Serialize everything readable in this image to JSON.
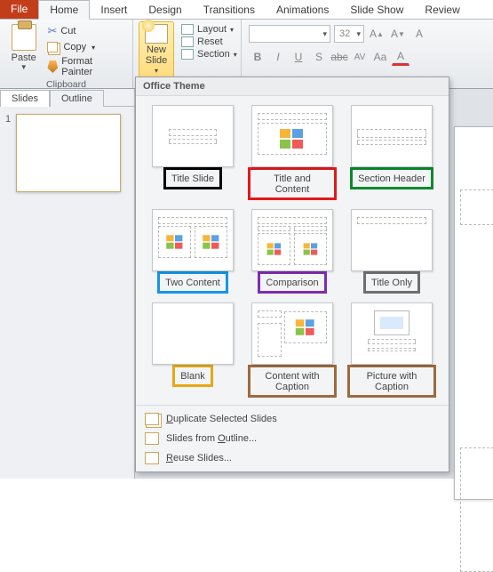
{
  "tabs": {
    "file": "File",
    "home": "Home",
    "insert": "Insert",
    "design": "Design",
    "transitions": "Transitions",
    "animations": "Animations",
    "slideshow": "Slide Show",
    "review": "Review"
  },
  "clipboard": {
    "group_label": "Clipboard",
    "paste_label": "Paste",
    "cut": "Cut",
    "copy": "Copy",
    "format_painter": "Format Painter"
  },
  "slides_group": {
    "new_slide_line1": "New",
    "new_slide_line2": "Slide",
    "layout": "Layout",
    "reset": "Reset",
    "section": "Section"
  },
  "font": {
    "family_placeholder": "",
    "size_value": "32"
  },
  "left_panel": {
    "tab_slides": "Slides",
    "tab_outline": "Outline",
    "slide_number": "1"
  },
  "gallery": {
    "header": "Office Theme",
    "items": [
      {
        "label": "Title Slide",
        "hl": "hl-black",
        "thumb": "title"
      },
      {
        "label": "Title and Content",
        "hl": "hl-red",
        "thumb": "title_content"
      },
      {
        "label": "Section Header",
        "hl": "hl-green",
        "thumb": "section"
      },
      {
        "label": "Two Content",
        "hl": "hl-blue",
        "thumb": "two"
      },
      {
        "label": "Comparison",
        "hl": "hl-purple",
        "thumb": "compare"
      },
      {
        "label": "Title Only",
        "hl": "hl-gray",
        "thumb": "titleonly"
      },
      {
        "label": "Blank",
        "hl": "hl-gold",
        "thumb": "blank"
      },
      {
        "label": "Content with Caption",
        "hl": "hl-brown",
        "thumb": "content_cap"
      },
      {
        "label": "Picture with Caption",
        "hl": "hl-brown2",
        "thumb": "pic_cap"
      }
    ],
    "footer": {
      "duplicate": "Duplicate Selected Slides",
      "outline": "Slides from Outline...",
      "reuse": "Reuse Slides..."
    }
  }
}
